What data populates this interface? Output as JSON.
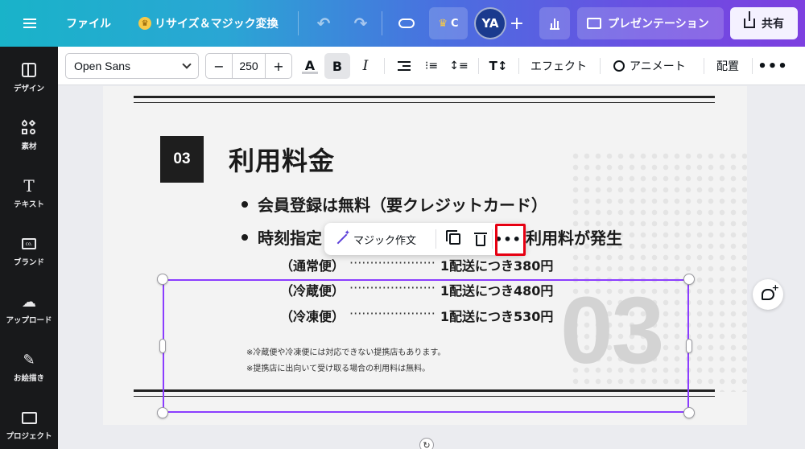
{
  "topbar": {
    "file_label": "ファイル",
    "resize_label": "リサイズ＆マジック変換",
    "pro_label": "C",
    "avatar_initials": "YA",
    "present_label": "プレゼンテーション",
    "share_label": "共有",
    "icons": {
      "menu": "hamburger-icon",
      "crown": "crown-icon",
      "undo": "undo-icon",
      "redo": "redo-icon",
      "cloud": "cloud-icon",
      "plus": "plus-icon",
      "stats": "bar-chart-icon",
      "present": "present-icon",
      "share": "share-icon"
    }
  },
  "sidebar": {
    "items": [
      {
        "label": "デザイン",
        "icon": "design-icon"
      },
      {
        "label": "素材",
        "icon": "elements-icon"
      },
      {
        "label": "テキスト",
        "icon": "text-icon"
      },
      {
        "label": "ブランド",
        "icon": "brand-icon"
      },
      {
        "label": "アップロード",
        "icon": "upload-icon"
      },
      {
        "label": "お絵描き",
        "icon": "draw-icon"
      },
      {
        "label": "プロジェクト",
        "icon": "folder-icon"
      }
    ]
  },
  "format_toolbar": {
    "font_name": "Open Sans",
    "font_size": "250",
    "minus": "−",
    "plus": "+",
    "color_letter": "A",
    "bold_letter": "B",
    "italic_letter": "I",
    "text_fx_symbol": "T↕",
    "effect_label": "エフェクト",
    "anime_label": "アニメート",
    "layout_label": "配置",
    "more_symbol": "•••"
  },
  "slide": {
    "badge_number": "03",
    "title": "利用料金",
    "bullet1": "会員登録は無料（要クレジットカード）",
    "bullet2_start": "時刻指定",
    "bullet2_end": "利用料が発生",
    "rates": [
      {
        "type": "（通常便）",
        "leader": "·····················",
        "price": "1配送につき380円"
      },
      {
        "type": "（冷蔵便）",
        "leader": "·····················",
        "price": "1配送につき480円"
      },
      {
        "type": "（冷凍便）",
        "leader": "·····················",
        "price": "1配送につき530円"
      }
    ],
    "big_number": "03",
    "note1": "※冷蔵便や冷凍便には対応できない提携店もあります。",
    "note2": "※提携店に出向いて受け取る場合の利用料は無料。"
  },
  "context_menu": {
    "magic_label": "マジック作文",
    "more_symbol": "•••",
    "icons": {
      "magic": "magic-wand-icon",
      "duplicate": "duplicate-icon",
      "delete": "trash-icon",
      "more": "more-icon"
    }
  },
  "colors": {
    "selection": "#8b3dff",
    "highlight": "#e60012",
    "sidebar_bg": "#18191b"
  }
}
